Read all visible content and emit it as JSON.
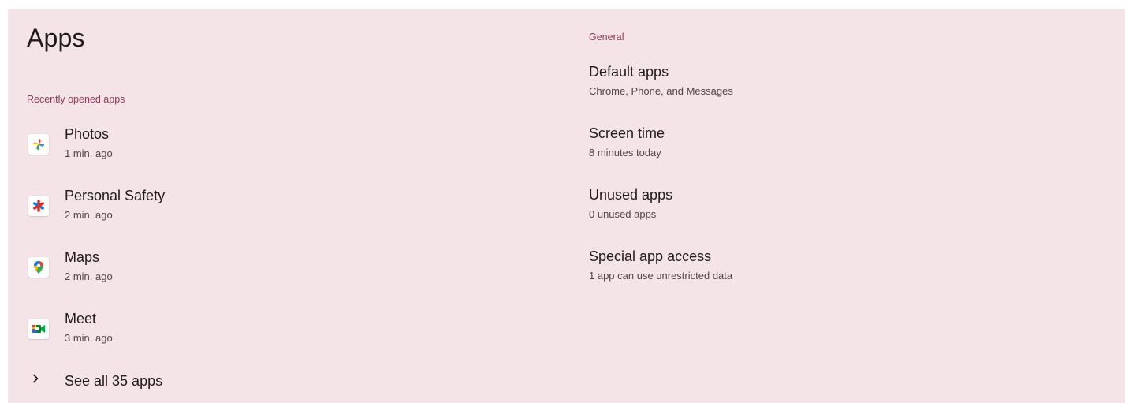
{
  "page": {
    "title": "Apps"
  },
  "recent": {
    "header": "Recently opened apps",
    "apps": [
      {
        "name": "Photos",
        "time": "1 min. ago",
        "icon": "photos-pinwheel-icon"
      },
      {
        "name": "Personal Safety",
        "time": "2 min. ago",
        "icon": "personal-safety-asterisk-icon"
      },
      {
        "name": "Maps",
        "time": "2 min. ago",
        "icon": "maps-pin-icon"
      },
      {
        "name": "Meet",
        "time": "3 min. ago",
        "icon": "meet-camera-icon"
      }
    ],
    "see_all_label": "See all 35 apps"
  },
  "general": {
    "header": "General",
    "items": [
      {
        "title": "Default apps",
        "subtitle": "Chrome, Phone, and Messages"
      },
      {
        "title": "Screen time",
        "subtitle": "8 minutes today"
      },
      {
        "title": "Unused apps",
        "subtitle": "0 unused apps"
      },
      {
        "title": "Special app access",
        "subtitle": "1 app can use unrestricted data"
      }
    ]
  },
  "colors": {
    "panel_background": "#f5e4e7",
    "section_header": "#8a3a5a",
    "primary_text": "#201a1c",
    "secondary_text": "#524346"
  }
}
